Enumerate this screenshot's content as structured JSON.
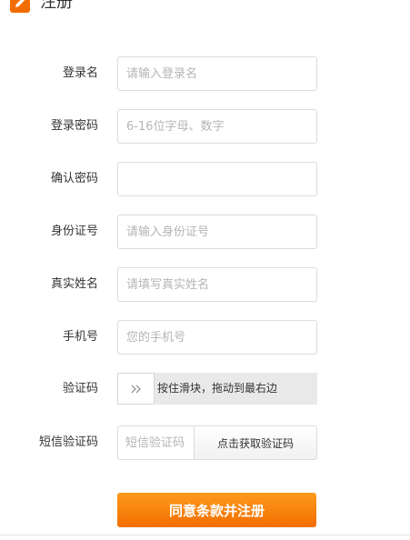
{
  "header": {
    "title": "注册",
    "accent_color": "#f26d00"
  },
  "form": {
    "login_name": {
      "label": "登录名",
      "placeholder": "请输入登录名"
    },
    "password": {
      "label": "登录密码",
      "placeholder": "6-16位字母、数字"
    },
    "confirm_password": {
      "label": "确认密码",
      "placeholder": ""
    },
    "id_number": {
      "label": "身份证号",
      "placeholder": "请输入身份证号"
    },
    "real_name": {
      "label": "真实姓名",
      "placeholder": "请填写真实姓名"
    },
    "phone": {
      "label": "手机号",
      "placeholder": "您的手机号"
    },
    "captcha": {
      "label": "验证码",
      "handle_icon": "double-chevron-right-icon",
      "hint": "按住滑块，拖动到最右边"
    },
    "sms_code": {
      "label": "短信验证码",
      "placeholder": "短信验证码",
      "button_label": "点击获取验证码"
    }
  },
  "submit_label": "同意条款并注册"
}
